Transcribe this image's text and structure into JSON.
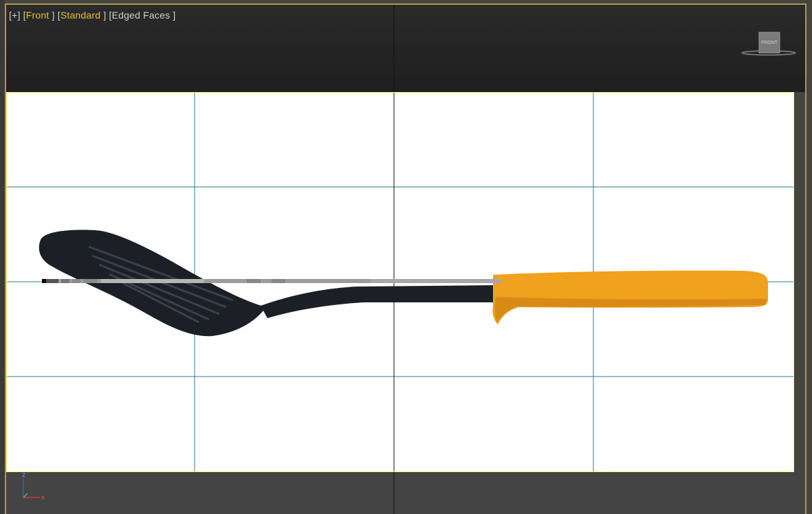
{
  "viewport": {
    "plus_menu": "[+]",
    "view_menu_open": "[",
    "view_name": "Front",
    "view_menu_close": "]",
    "shading_open": "[",
    "shading_name": "Standard",
    "shading_close": "]",
    "edged_faces": "[Edged Faces ]"
  },
  "view_cube": {
    "face_label": "FRONT"
  },
  "axis_tripod": {
    "z": "z",
    "x": "x"
  },
  "colors": {
    "active_label": "#e6c229",
    "frame_border": "#ffff66",
    "grid_line": "#2a7f96",
    "handle_orange": "#f0a21e",
    "spatula_black": "#1c1f26"
  }
}
